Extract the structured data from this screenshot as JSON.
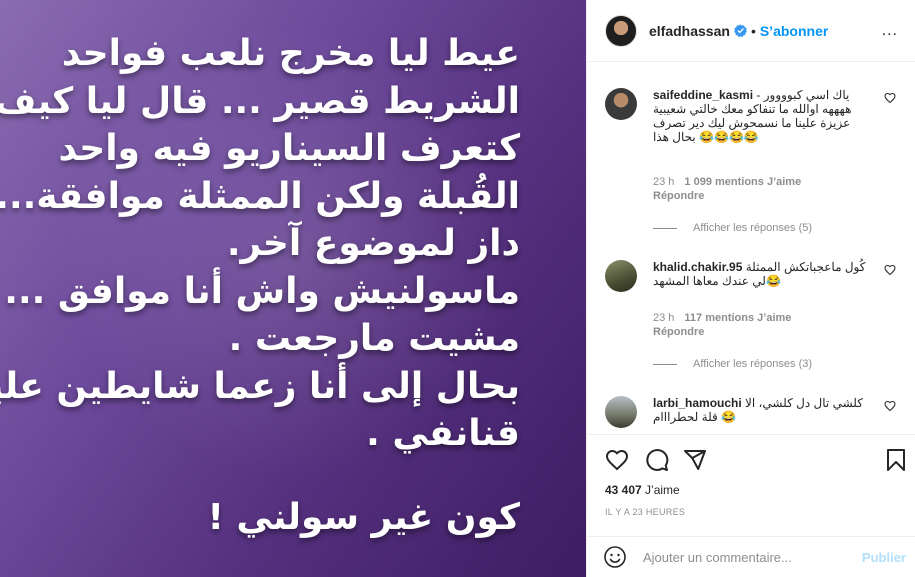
{
  "post": {
    "lines": [
      "عيط ليا مخرج نلعب فواحد",
      "الشريط قصير ... قال ليا كيف",
      "كتعرف السيناريو فيه واحد",
      "القُبلة ولكن الممثلة موافقة...و",
      "داز لموضوع آخر.",
      "ماسولنيش واش أنا موافق ...",
      "مشيت مارجعت .",
      "بحال إلى أنا زعما شايطين عليا",
      "قنانفي ."
    ],
    "closing": "كون غير سولني !"
  },
  "header": {
    "username": "elfadhassan",
    "dot": "•",
    "follow_label": "S’abonner",
    "more": "..."
  },
  "comments": [
    {
      "username": "saifeddine_kasmi",
      "text": "ياك اسي كبوووور - ههههه اوالله ما تنفاكو معك خالتي شعيبية عزيزة علينا ما نسمحوش ليك دير تصرف بحال هذا 😂😂😂😂",
      "time": "23 h",
      "likes": "1 099 mentions J’aime",
      "reply": "Répondre",
      "view_replies": "Afficher les réponses (5)"
    },
    {
      "username": "khalid.chakir.95",
      "text": "كُول ماعجباتكش الممثلة 😂لي عندك معاها المشهد",
      "time": "23 h",
      "likes": "117 mentions J’aime",
      "reply": "Répondre",
      "view_replies": "Afficher les réponses (3)"
    },
    {
      "username": "larbi_hamouchi",
      "text": "كلشي تال دل كلشي، الا 😂 قلة لحطرااام"
    }
  ],
  "stats": {
    "likes_count": "43 407",
    "likes_label": "J’aime",
    "time_ago": "IL Y A 23 HEURES"
  },
  "add_comment": {
    "placeholder": "Ajouter un commentaire...",
    "publish_label": "Publier"
  },
  "icons": {
    "verified": "verified-badge-icon",
    "heart": "heart-icon",
    "comment": "comment-icon",
    "share": "share-icon",
    "save": "bookmark-icon",
    "emoji": "emoji-icon"
  },
  "colors": {
    "accent": "#0095f6",
    "publish_disabled": "#b2dffc",
    "muted": "#8e8e8e",
    "image_purple": "#6d4a9c"
  }
}
